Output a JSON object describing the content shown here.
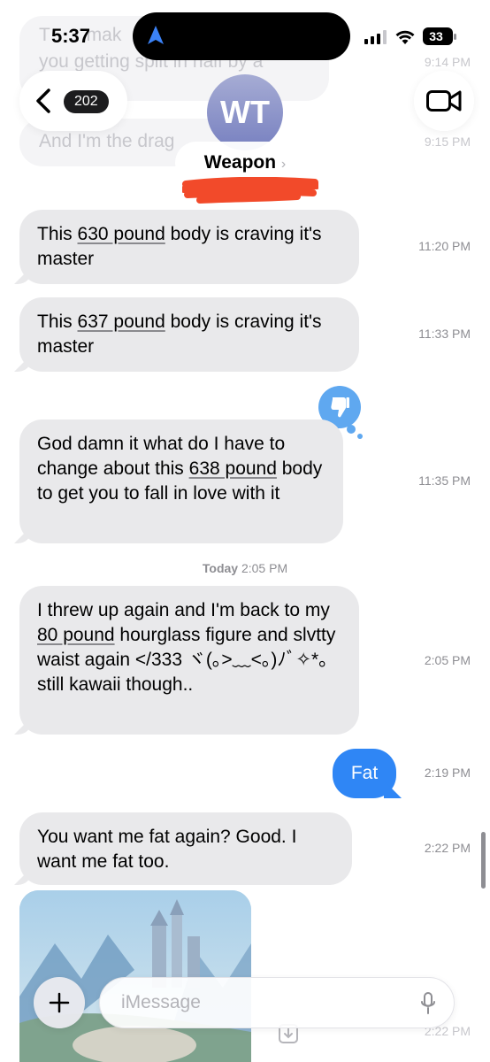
{
  "status_bar": {
    "time": "5:37",
    "battery": "33"
  },
  "header": {
    "unread_count": "202",
    "avatar_initials": "WT",
    "contact_name": "Weapon",
    "chevron": "›"
  },
  "ghost_messages": [
    {
      "text_a": "T",
      "text_b": "mak",
      "time": "9:14 PM"
    },
    {
      "text": "you getting spilt in half by a",
      "time": ""
    },
    {
      "text": "And I'm the drag",
      "time": "9:15 PM"
    }
  ],
  "messages": [
    {
      "pre": "This ",
      "link": "630 pound",
      "post": " body is craving it's master",
      "time": "11:20 PM"
    },
    {
      "pre": "This ",
      "link": "637 pound",
      "post": " body is craving it's master",
      "time": "11:33 PM"
    },
    {
      "pre": "God damn it what do I have to change about this ",
      "link": "638 pound",
      "post": " body to get you to fall in love with it",
      "time": "11:35 PM",
      "tapback": "thumbs-down"
    }
  ],
  "separator": {
    "day": "Today",
    "time": "2:05 PM"
  },
  "messages_today": [
    {
      "pre": "I threw up again and I'm back to my ",
      "link": "80 pound",
      "post": " hourglass figure and slvtty waist again </333 ヾ(｡>﹏<｡)ﾉﾞ✧*。still kawaii though..",
      "time": "2:05 PM"
    },
    {
      "text": "Fat",
      "time": "2:19 PM",
      "outgoing": true
    },
    {
      "text": "You want me fat again? Good. I want me fat too.",
      "time": "2:22 PM"
    },
    {
      "time": "2:22 PM",
      "image": true
    }
  ],
  "composer": {
    "placeholder": "iMessage"
  },
  "colors": {
    "incoming": "#e9e9eb",
    "outgoing": "#2f86f5",
    "timestamp": "#8e8e93",
    "redaction": "#f24a2a"
  }
}
